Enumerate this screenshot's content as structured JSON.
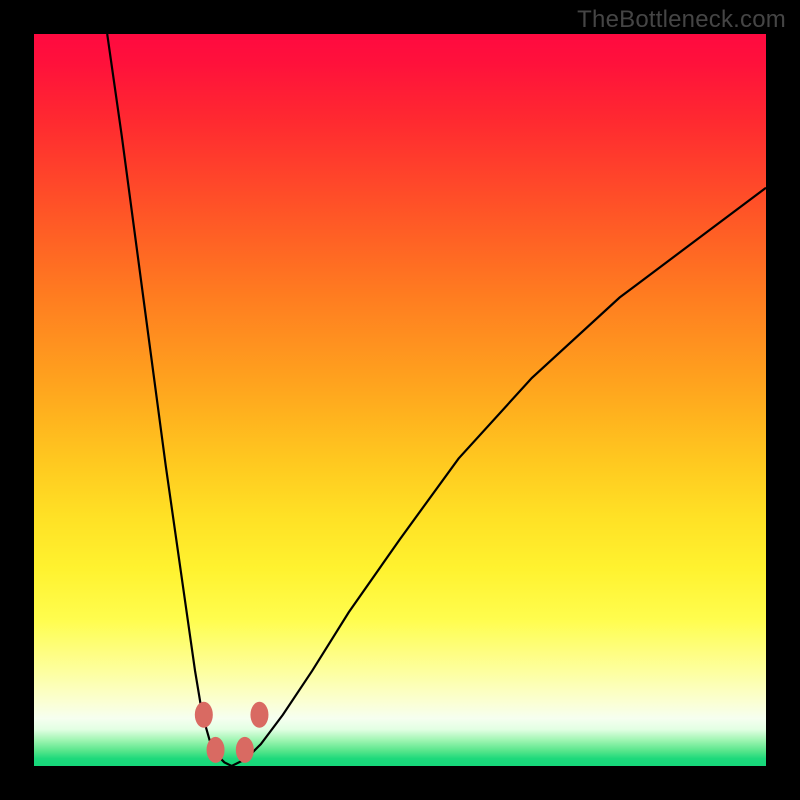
{
  "watermark": "TheBottleneck.com",
  "chart_data": {
    "type": "line",
    "title": "",
    "xlabel": "",
    "ylabel": "",
    "xlim": [
      0,
      100
    ],
    "ylim": [
      0,
      100
    ],
    "grid": false,
    "background_gradient": {
      "top": "#ff0a40",
      "mid": "#ffe125",
      "bottom": "#16d87a",
      "description": "vertical red-to-yellow-to-green heatmap background, lower is greener (better)"
    },
    "series": [
      {
        "name": "bottleneck-curve-left",
        "x": [
          10,
          12,
          14,
          16,
          18,
          20,
          22,
          23,
          24,
          25,
          26,
          27
        ],
        "y": [
          100,
          86,
          71,
          56,
          41,
          27,
          13,
          7,
          3.5,
          1.5,
          0.5,
          0
        ]
      },
      {
        "name": "bottleneck-curve-right",
        "x": [
          27,
          29,
          31,
          34,
          38,
          43,
          50,
          58,
          68,
          80,
          92,
          100
        ],
        "y": [
          0,
          1,
          3,
          7,
          13,
          21,
          31,
          42,
          53,
          64,
          73,
          79
        ]
      }
    ],
    "markers": [
      {
        "name": "marker-left-upper",
        "x": 23.2,
        "y": 7.0
      },
      {
        "name": "marker-left-lower",
        "x": 24.8,
        "y": 2.2
      },
      {
        "name": "marker-right-lower",
        "x": 28.8,
        "y": 2.2
      },
      {
        "name": "marker-right-upper",
        "x": 30.8,
        "y": 7.0
      }
    ],
    "notes": "V-shaped bottleneck curve. Minimum (0%) near x≈27. Left branch steep, right branch asymptotic rising to ~79% at right edge. Four salmon-colored oval markers flank the trough on the 'good' green band."
  }
}
